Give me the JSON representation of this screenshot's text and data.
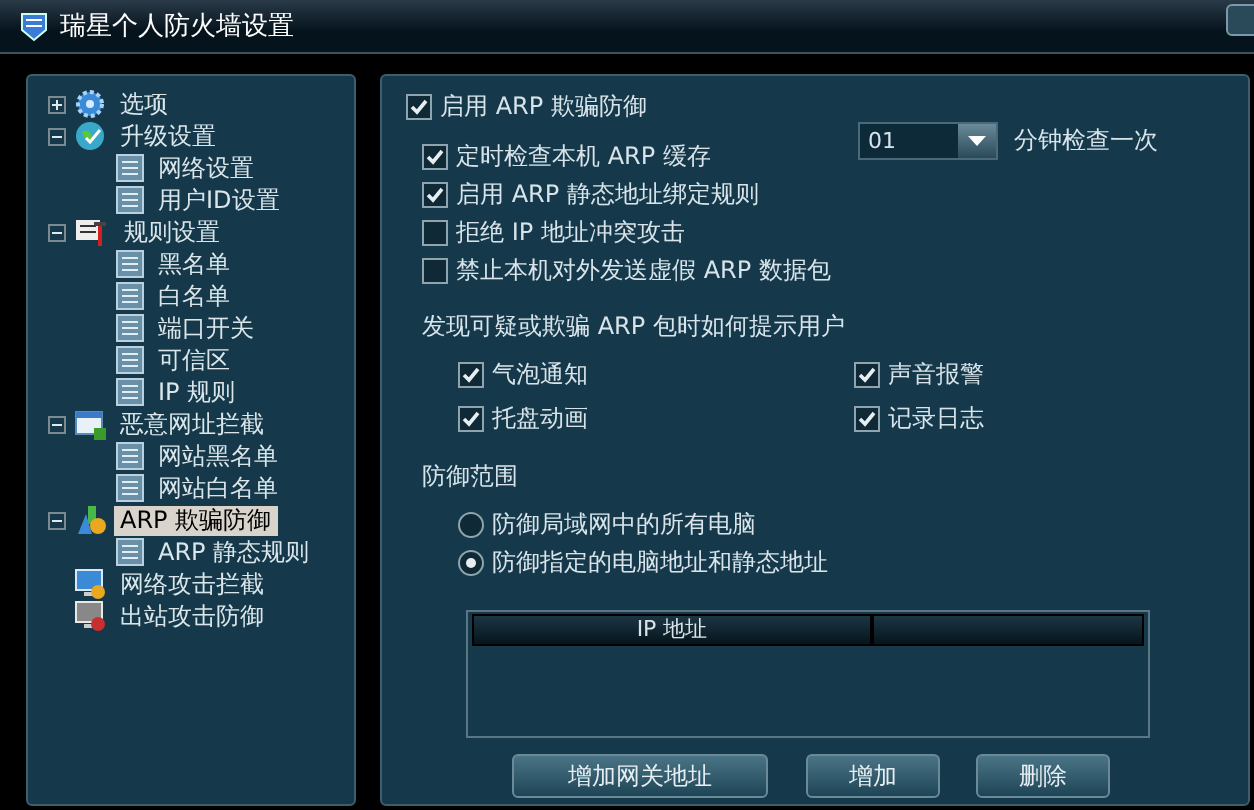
{
  "window": {
    "title": "瑞星个人防火墙设置"
  },
  "tree": [
    {
      "label": "选项",
      "expanded": false,
      "selected": false
    },
    {
      "label": "升级设置",
      "expanded": true,
      "selected": false,
      "children": [
        {
          "label": "网络设置",
          "selected": false
        },
        {
          "label": "用户ID设置",
          "selected": false
        }
      ]
    },
    {
      "label": "规则设置",
      "expanded": true,
      "selected": false,
      "children": [
        {
          "label": "黑名单",
          "selected": false
        },
        {
          "label": "白名单",
          "selected": false
        },
        {
          "label": "端口开关",
          "selected": false
        },
        {
          "label": "可信区",
          "selected": false
        },
        {
          "label": "IP 规则",
          "selected": false
        }
      ]
    },
    {
      "label": "恶意网址拦截",
      "expanded": true,
      "selected": false,
      "children": [
        {
          "label": "网站黑名单",
          "selected": false
        },
        {
          "label": "网站白名单",
          "selected": false
        }
      ]
    },
    {
      "label": "ARP 欺骗防御",
      "expanded": true,
      "selected": true,
      "children": [
        {
          "label": "ARP 静态规则",
          "selected": false
        }
      ]
    },
    {
      "label": "网络攻击拦截",
      "selected": false
    },
    {
      "label": "出站攻击防御",
      "selected": false
    }
  ],
  "main_toggle": {
    "label": "启用 ARP 欺骗防御",
    "checked": true
  },
  "options": [
    {
      "label": "定时检查本机 ARP 缓存",
      "checked": true
    },
    {
      "label": "启用 ARP 静态地址绑定规则",
      "checked": true
    },
    {
      "label": "拒绝 IP 地址冲突攻击",
      "checked": false
    },
    {
      "label": "禁止本机对外发送虚假 ARP 数据包",
      "checked": false
    }
  ],
  "interval": {
    "value": "01",
    "label": "分钟检查一次"
  },
  "notify": {
    "heading": "发现可疑或欺骗 ARP 包时如何提示用户",
    "options": [
      {
        "label": "气泡通知",
        "checked": true
      },
      {
        "label": "声音报警",
        "checked": true
      },
      {
        "label": "托盘动画",
        "checked": true
      },
      {
        "label": "记录日志",
        "checked": true
      }
    ]
  },
  "scope": {
    "heading": "防御范围",
    "options": [
      {
        "label": "防御局域网中的所有电脑",
        "selected": false
      },
      {
        "label": "防御指定的电脑地址和静态地址",
        "selected": true
      }
    ],
    "table": {
      "columns": [
        "IP 地址"
      ]
    }
  },
  "buttons": [
    "增加网关地址",
    "增加",
    "删除"
  ]
}
